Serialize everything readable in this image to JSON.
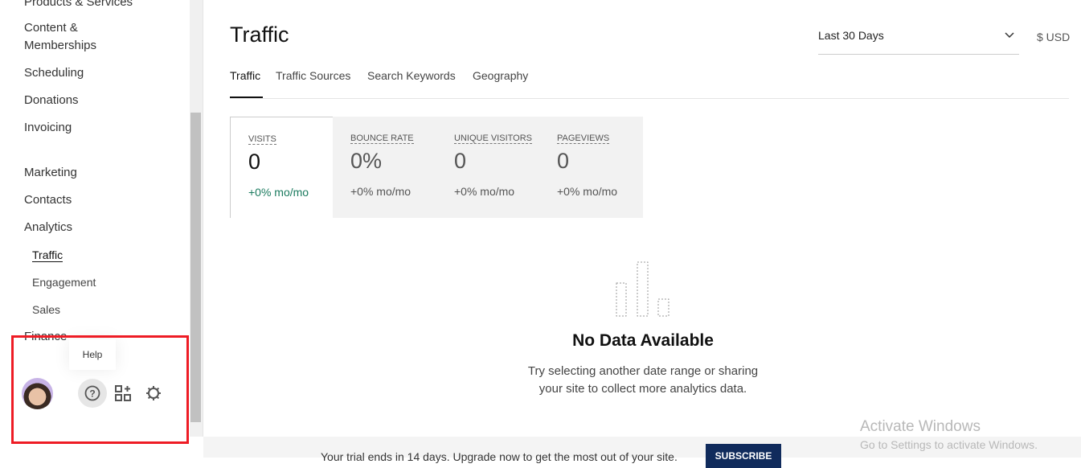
{
  "sidebar": {
    "items": [
      "Products & Services",
      "Content & Memberships",
      "Scheduling",
      "Donations",
      "Invoicing",
      "Marketing",
      "Contacts",
      "Analytics",
      "Finance"
    ],
    "subitems": [
      "Traffic",
      "Engagement",
      "Sales"
    ],
    "tooltip": "Help",
    "icons": [
      "avatar",
      "help-icon",
      "add-block-icon",
      "gear-icon"
    ]
  },
  "header": {
    "title": "Traffic",
    "date_range": "Last 30 Days",
    "currency": "$ USD"
  },
  "tabs": [
    "Traffic",
    "Traffic Sources",
    "Search Keywords",
    "Geography"
  ],
  "cards": [
    {
      "label": "VISITS",
      "value": "0",
      "change": "+0% mo/mo"
    },
    {
      "label": "BOUNCE RATE",
      "value": "0%",
      "change": "+0% mo/mo"
    },
    {
      "label": "UNIQUE VISITORS",
      "value": "0",
      "change": "+0% mo/mo"
    },
    {
      "label": "PAGEVIEWS",
      "value": "0",
      "change": "+0% mo/mo"
    }
  ],
  "empty": {
    "title": "No Data Available",
    "line1": "Try selecting another date range or sharing",
    "line2": "your site to collect more analytics data."
  },
  "banner": {
    "text": "Your trial ends in 14 days. Upgrade now to get the most out of your site.",
    "button": "SUBSCRIBE"
  },
  "watermark": {
    "title": "Activate Windows",
    "subtitle": "Go to Settings to activate Windows."
  },
  "colors": {
    "accent_green": "#1a7a5e",
    "subscribe": "#102b5c",
    "highlight": "#ee1c25"
  }
}
